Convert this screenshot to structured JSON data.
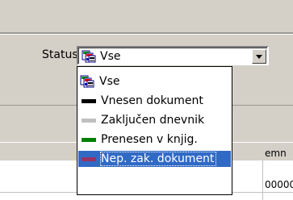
{
  "filter": {
    "status_label": "Status",
    "selected_value": "Vse",
    "selected_icon": "stacked-documents-icon"
  },
  "dropdown": {
    "options": [
      {
        "label": "Vse",
        "icon": "stacked-documents-icon"
      },
      {
        "label": "Vnesen dokument",
        "color": "#000000"
      },
      {
        "label": "Zaključen dnevnik",
        "color": "#c0c0c0"
      },
      {
        "label": "Prenesen v knjig.",
        "color": "#008000"
      },
      {
        "label": "Nep. zak. dokument",
        "color": "#993366"
      }
    ],
    "highlighted_index": 4,
    "highlight_color": "#316ac5"
  },
  "grid": {
    "header_partial": "emn",
    "cell_partial": "000000"
  }
}
